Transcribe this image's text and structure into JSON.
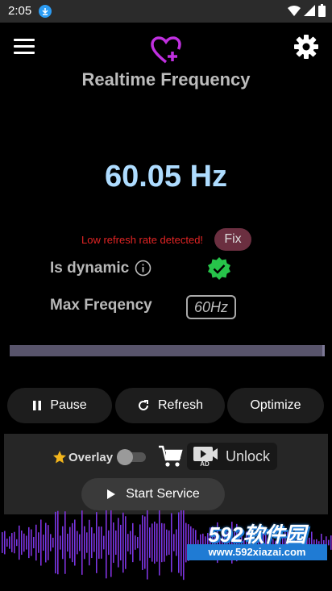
{
  "status_bar": {
    "time": "2:05"
  },
  "header": {
    "title": "Realtime Frequency"
  },
  "frequency": {
    "value": "60.05 Hz"
  },
  "warning": {
    "text": "Low refresh rate detected!",
    "fix_label": "Fix"
  },
  "dynamic": {
    "label": "Is dynamic"
  },
  "max_freq": {
    "label": "Max Freqency",
    "value": "60Hz"
  },
  "buttons": {
    "pause": "Pause",
    "refresh": "Refresh",
    "optimize": "Optimize"
  },
  "overlay": {
    "label": "Overlay",
    "unlock": "Unlock",
    "ad_badge": "AD",
    "start": "Start Service"
  },
  "watermark": {
    "main": "592软件园",
    "sub": "www.592xiazai.com"
  },
  "colors": {
    "freq": "#aedcff",
    "warning": "#e22424",
    "accent": "#c030e0",
    "check": "#27c44a"
  },
  "icons": [
    "menu-icon",
    "heart-plus-icon",
    "gear-icon",
    "info-icon",
    "check-badge-icon",
    "pause-icon",
    "refresh-icon",
    "star-icon",
    "cart-icon",
    "play-icon",
    "video-ad-icon"
  ]
}
